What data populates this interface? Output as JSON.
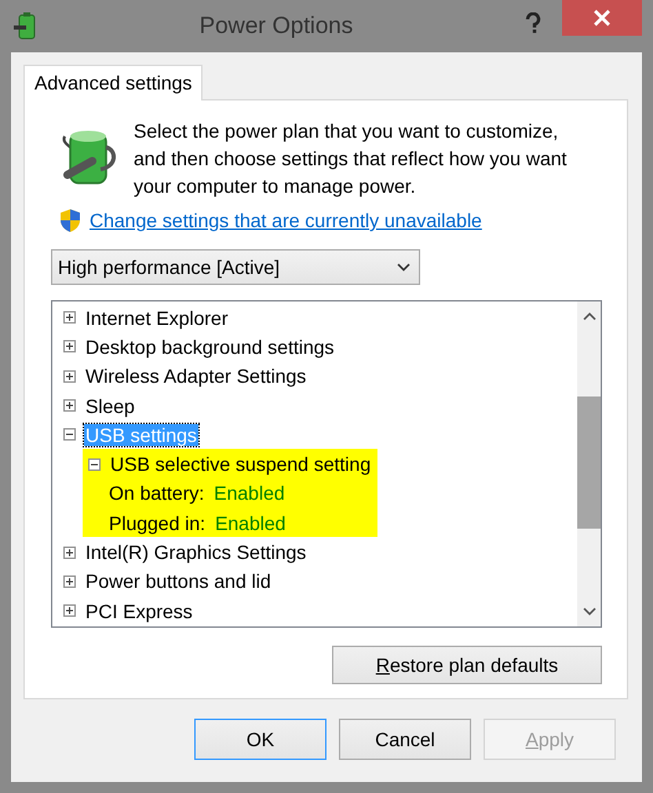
{
  "window": {
    "title": "Power Options"
  },
  "tabs": [
    {
      "label": "Advanced settings",
      "selected": true
    }
  ],
  "intro": "Select the power plan that you want to customize, and then choose settings that reflect how you want your computer to manage power.",
  "change_link": "Change settings that are currently unavailable",
  "plan_dropdown": {
    "value": "High performance [Active]"
  },
  "tree": [
    {
      "label": "Internet Explorer",
      "expanded": false,
      "selected": false
    },
    {
      "label": "Desktop background settings",
      "expanded": false,
      "selected": false
    },
    {
      "label": "Wireless Adapter Settings",
      "expanded": false,
      "selected": false
    },
    {
      "label": "Sleep",
      "expanded": false,
      "selected": false
    },
    {
      "label": "USB settings",
      "expanded": true,
      "selected": true,
      "children": [
        {
          "label": "USB selective suspend setting",
          "expanded": true,
          "selected": false,
          "highlighted": true,
          "children": [
            {
              "kind": "value",
              "label": "On battery:",
              "value": "Enabled",
              "selected": false
            },
            {
              "kind": "value",
              "label": "Plugged in:",
              "value": "Enabled",
              "selected": false
            }
          ]
        }
      ]
    },
    {
      "label": "Intel(R) Graphics Settings",
      "expanded": false,
      "selected": false
    },
    {
      "label": "Power buttons and lid",
      "expanded": false,
      "selected": false
    },
    {
      "label": "PCI Express",
      "expanded": false,
      "selected": false
    }
  ],
  "restore_button": {
    "access_key": "R",
    "label_rest": "estore plan defaults"
  },
  "buttons": [
    {
      "label": "OK",
      "default": true,
      "disabled": false
    },
    {
      "label": "Cancel",
      "default": false,
      "disabled": false
    },
    {
      "access_key": "A",
      "label_rest": "pply",
      "default": false,
      "disabled": true
    }
  ]
}
